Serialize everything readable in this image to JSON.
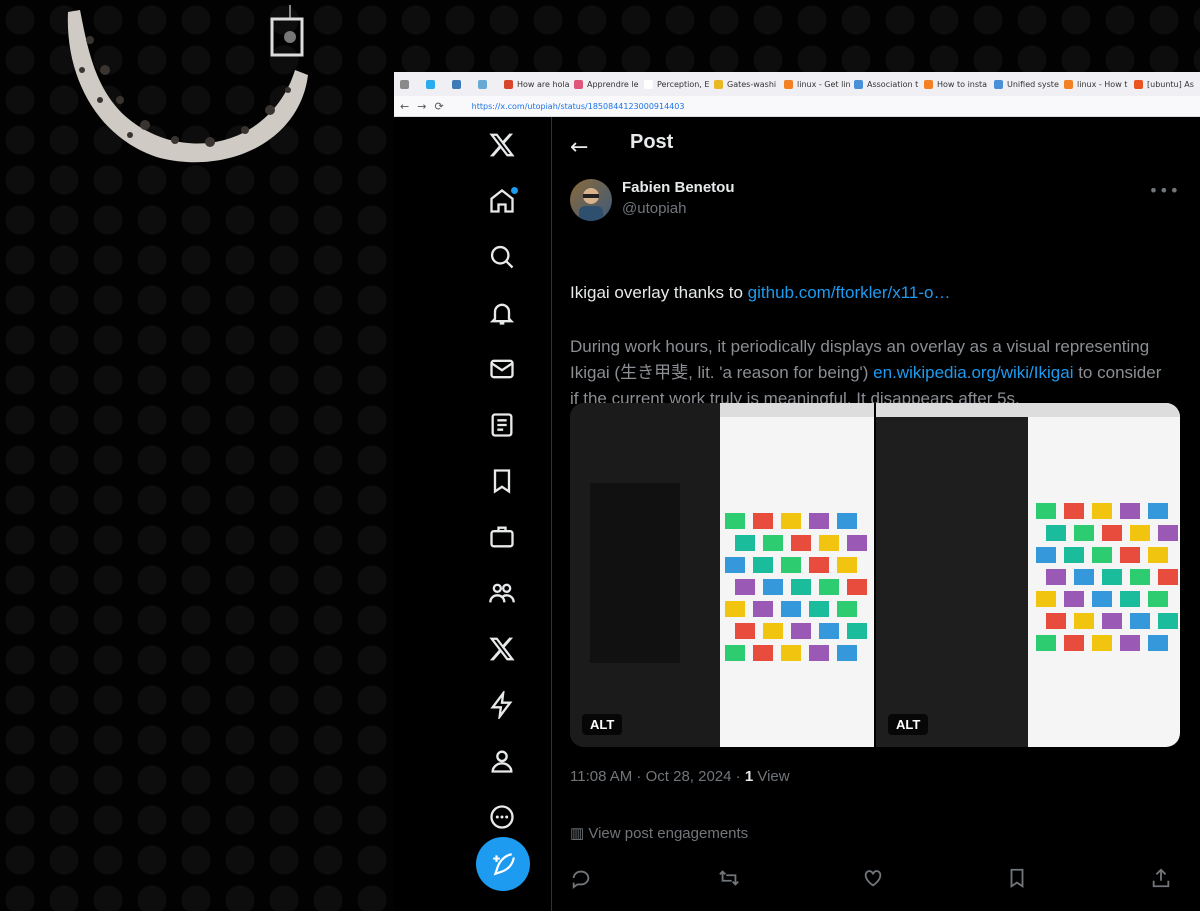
{
  "browser": {
    "tabs": [
      {
        "label": "",
        "color": "#8a8a8a"
      },
      {
        "label": "",
        "color": "#2aabee"
      },
      {
        "label": "",
        "color": "#3d7ab8"
      },
      {
        "label": "",
        "color": "#6aa9d4"
      },
      {
        "label": "How are hola",
        "color": "#d9452b"
      },
      {
        "label": "Apprendre le",
        "color": "#e0557a"
      },
      {
        "label": "Perception, Evol",
        "color": "#ffffff"
      },
      {
        "label": "Gates-washi",
        "color": "#e8b923"
      },
      {
        "label": "linux - Get lin",
        "color": "#f48024"
      },
      {
        "label": "Association t",
        "color": "#4a90d9"
      },
      {
        "label": "How to insta",
        "color": "#f48024"
      },
      {
        "label": "Unified syste",
        "color": "#4a90d9"
      },
      {
        "label": "linux - How t",
        "color": "#f48024"
      },
      {
        "label": "[ubuntu] As",
        "color": "#e95420"
      }
    ],
    "url": "https://x.com/utopiah/status/1850844123000914403"
  },
  "post": {
    "header": "Post",
    "author_name": "Fabien Benetou",
    "author_handle": "@utopiah",
    "line1_prefix": "Ikigai overlay thanks to ",
    "line1_link": "github.com/ftorkler/x11-o…",
    "body_prefix": "During work hours, it periodically displays an overlay as a visual representing Ikigai (生き甲斐, lit. 'a reason for being') ",
    "body_link": "en.wikipedia.org/wiki/Ikigai",
    "body_suffix": " to consider if the current work truly is meaningful. It disappears after 5s.",
    "alt_label": "ALT",
    "timestamp": "11:08 AM · Oct 28, 2024 · ",
    "views_count": "1",
    "views_label": " View",
    "engagements": "View post engagements"
  },
  "ascii_art": "",
  "colors": {
    "accent": "#1d9bf0",
    "background": "#000000",
    "muted": "#71767b"
  }
}
